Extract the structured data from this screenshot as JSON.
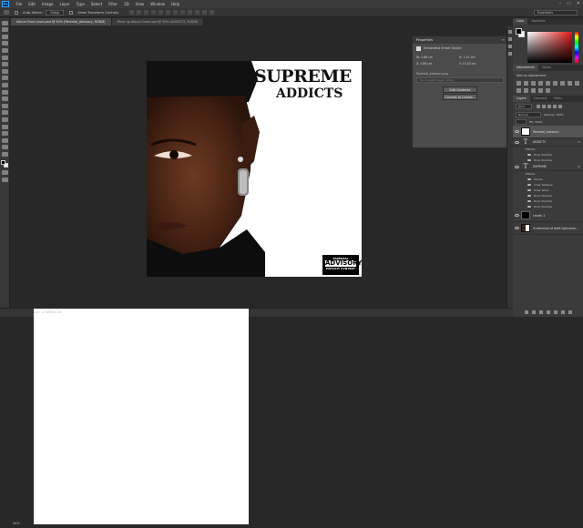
{
  "menubar": {
    "logo": "Ps",
    "items": [
      "File",
      "Edit",
      "Image",
      "Layer",
      "Type",
      "Select",
      "Filter",
      "3D",
      "View",
      "Window",
      "Help"
    ],
    "window_controls": [
      "–",
      "▭",
      "✕"
    ]
  },
  "options": {
    "auto_select_label": "Auto-Select:",
    "auto_select_value": "Group",
    "show_transform_label": "Show Transform Controls",
    "workspace": "Essentials"
  },
  "tabs": [
    {
      "label": "Album Front cover.psd @ 50% (Parental_Advisory, RGB/8)"
    },
    {
      "label": "Mock up Album Cover.psd @ 39% (ADDICTS, RGB/8)"
    }
  ],
  "artwork": {
    "title_line1": "SUPREME",
    "title_line2": "ADDICTS",
    "advisory_top": "PARENTAL",
    "advisory_mid": "ADVISORY",
    "advisory_bottom": "EXPLICIT CONTENT"
  },
  "properties": {
    "header": "Properties",
    "object_label": "Embedded Smart Object",
    "w_label": "W: 1.86 cm",
    "h_label": "H: 1.01 cm",
    "x_label": "X: 3.86 cm",
    "y_label": "Y: 10.03 cm",
    "file": "Parental_Advisory.png",
    "layer_comp": "Don't Apply Layer Comp",
    "edit_button": "Edit Contents",
    "convert_button": "Convert to Linked..."
  },
  "color_panel": {
    "tabs": [
      "Color",
      "Swatches"
    ],
    "fg_color": "#000000",
    "bg_color": "#ffffff",
    "hue_color": "#e11a1a"
  },
  "adjustments": {
    "tabs": [
      "Adjustments",
      "Styles"
    ],
    "title": "Add an adjustment"
  },
  "layers_panel": {
    "tabs": [
      "Layers",
      "Channels",
      "Paths"
    ],
    "kind": "Kind",
    "blend_mode": "Normal",
    "opacity_label": "Opacity: 100%",
    "fill_label": "Fill: 100%"
  },
  "layers": [
    {
      "name": "Parental_Advisory",
      "type": "image",
      "fx": ""
    },
    {
      "name": "ADDICTS",
      "type": "text",
      "fx": "fx"
    },
    {
      "name": "SUPREME",
      "type": "text",
      "fx": "fx"
    },
    {
      "name": "Levels 1",
      "type": "adjustment",
      "fx": ""
    },
    {
      "name": "Screenshot of draft lightroom...",
      "type": "photo",
      "fx": ""
    }
  ],
  "effects": {
    "addicts": [
      "Effects",
      "Drop Shadow",
      "Drop Shadow"
    ],
    "supreme": [
      "Effects",
      "Stroke",
      "Inner Shadow",
      "Inner Glow",
      "Drop Shadow",
      "Drop Shadow",
      "Drop Shadow"
    ]
  },
  "status": {
    "zoom": "50%",
    "doc": "Doc: 2.78M/24.1M"
  }
}
